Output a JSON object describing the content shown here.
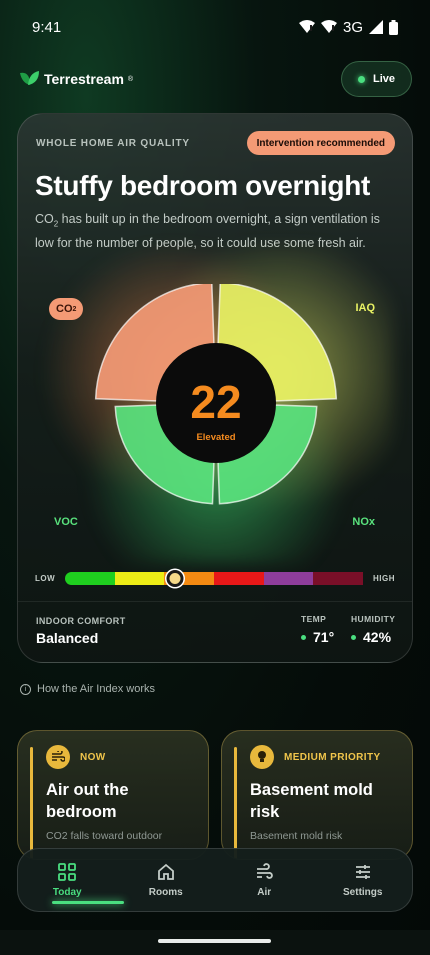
{
  "status_bar": {
    "time": "9:41",
    "network": "3G"
  },
  "app": {
    "brand_name": "Terrestream",
    "brand_mark": "®",
    "live_label": "Live"
  },
  "hero": {
    "label": "WHOLE HOME AIR QUALITY",
    "badge": "Intervention recommended",
    "title": "Stuffy bedroom overnight",
    "description_prefix": "CO",
    "description_sub": "2",
    "description_rest": " has built up in the bedroom overnight, a sign ventilation is low for the number of people, so it could use some fresh air.",
    "score": "22",
    "score_label": "Elevated",
    "quadrants": {
      "co2": {
        "label_main": "CO",
        "label_sub": "2",
        "color": "#f49a75",
        "level": 0.86
      },
      "iaq": {
        "label": "IAQ",
        "color": "#e9f264",
        "level": 0.86
      },
      "voc": {
        "label": "VOC",
        "color": "#59e27d",
        "level": 0.72
      },
      "nox": {
        "label": "NOx",
        "color": "#59e27d",
        "level": 0.72
      }
    },
    "scale": {
      "low_label": "LOW",
      "high_label": "HIGH",
      "colors": [
        "#1fcf1f",
        "#ecec16",
        "#f38a12",
        "#e81818",
        "#8e3d9b",
        "#7a0f28"
      ],
      "position": 0.37
    },
    "comfort_label": "INDOOR COMFORT",
    "comfort_value": "Balanced",
    "temp_label": "TEMP",
    "temp_value": "71°",
    "humidity_label": "HUMIDITY",
    "humidity_value": "42%"
  },
  "info_link": "How the Air Index works",
  "cards": [
    {
      "tag": "NOW",
      "title": "Air out the bedroom",
      "subtitle": "CO2 falls toward outdoor",
      "icon": "wind-icon"
    },
    {
      "tag": "MEDIUM PRIORITY",
      "title": "Basement mold risk",
      "subtitle": "Basement mold risk",
      "icon": "lightbulb-icon"
    }
  ],
  "nav": [
    {
      "label": "Today",
      "icon": "grid-icon",
      "active": true
    },
    {
      "label": "Rooms",
      "icon": "home-icon",
      "active": false
    },
    {
      "label": "Air",
      "icon": "wind-icon",
      "active": false
    },
    {
      "label": "Settings",
      "icon": "sliders-icon",
      "active": false
    }
  ],
  "colors": {
    "accent_green": "#4ade80",
    "badge_orange": "#f49a75",
    "card_gold": "#e8b83c",
    "score_orange": "#f58b1f"
  }
}
